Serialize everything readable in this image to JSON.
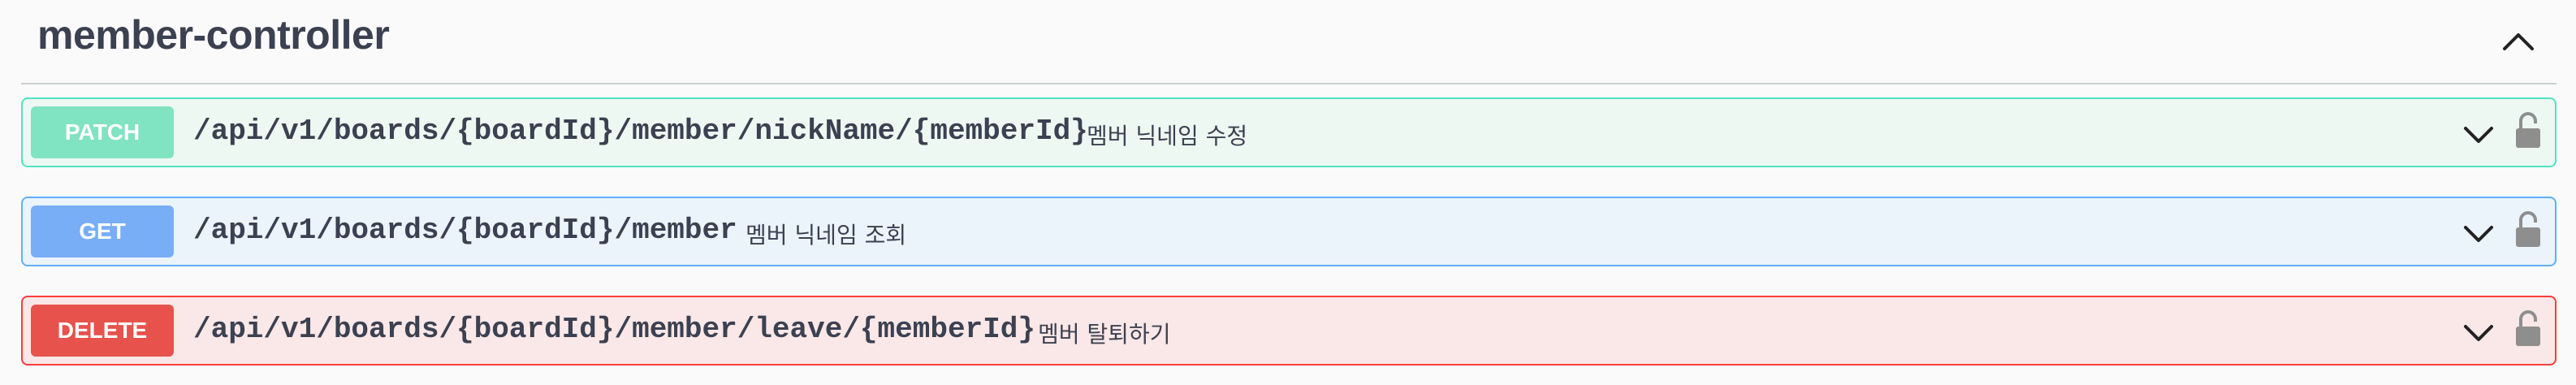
{
  "section": {
    "title": "member-controller"
  },
  "operations": [
    {
      "method": "PATCH",
      "path": "/api/v1/boards/{boardId}/member/nickName/{memberId}",
      "summary": "멤버 닉네임 수정",
      "color": "#80e3c1"
    },
    {
      "method": "GET",
      "path": "/api/v1/boards/{boardId}/member",
      "summary": "멤버 닉네임 조회",
      "color": "#77aef6"
    },
    {
      "method": "DELETE",
      "path": "/api/v1/boards/{boardId}/member/leave/{memberId}",
      "summary": "멤버 탈퇴하기",
      "color": "#e7524c"
    }
  ],
  "icons": {
    "collapse": "chevron-up-icon",
    "expand": "chevron-down-icon",
    "auth": "lock-icon"
  }
}
